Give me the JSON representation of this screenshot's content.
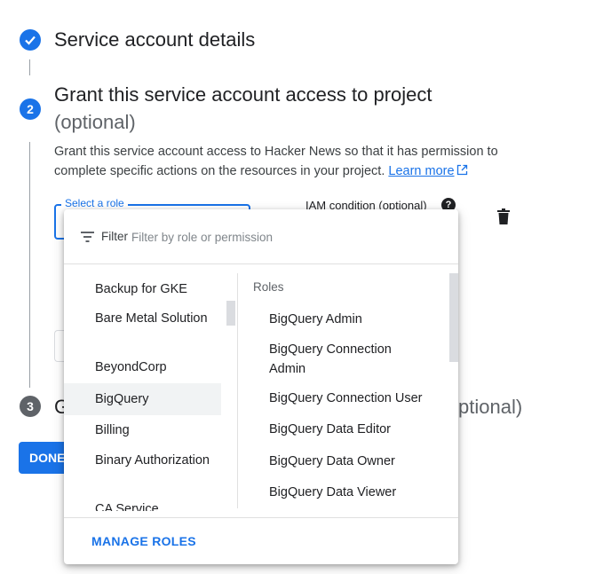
{
  "steps": {
    "step1": {
      "title": "Service account details"
    },
    "step2": {
      "number": "2",
      "title": "Grant this service account access to project",
      "optional": "(optional)",
      "description": "Grant this service account access to Hacker News so that it has permission to complete specific actions on the resources in your project.",
      "learn_more": "Learn more"
    },
    "step3": {
      "number": "3",
      "title_visible": "G",
      "optional_visible": "ptional)"
    }
  },
  "role_select": {
    "label": "Select a role"
  },
  "iam_condition": {
    "label": "IAM condition (optional)"
  },
  "done_button": {
    "label": "DONE"
  },
  "menu": {
    "filter_label": "Filter",
    "filter_placeholder": "Filter by role or permission",
    "categories": [
      {
        "label": "Backup for GKE"
      },
      {
        "label": "Bare Metal Solution"
      },
      {
        "label": "BeyondCorp"
      },
      {
        "label": "BigQuery",
        "selected": true
      },
      {
        "label": "Billing"
      },
      {
        "label": "Binary Authorization"
      },
      {
        "label": "CA Service"
      }
    ],
    "roles_header": "Roles",
    "roles": [
      {
        "label": "BigQuery Admin"
      },
      {
        "label": "BigQuery Connection Admin"
      },
      {
        "label": "BigQuery Connection User"
      },
      {
        "label": "BigQuery Data Editor"
      },
      {
        "label": "BigQuery Data Owner"
      },
      {
        "label": "BigQuery Data Viewer"
      }
    ],
    "manage_roles": "MANAGE ROLES"
  },
  "colors": {
    "accent": "#1a73e8",
    "pending_step": "#5f6368",
    "selected_bg": "#f1f3f4"
  },
  "icons": [
    "check-icon",
    "filter-icon",
    "help-icon",
    "trash-icon",
    "external-link-icon"
  ]
}
